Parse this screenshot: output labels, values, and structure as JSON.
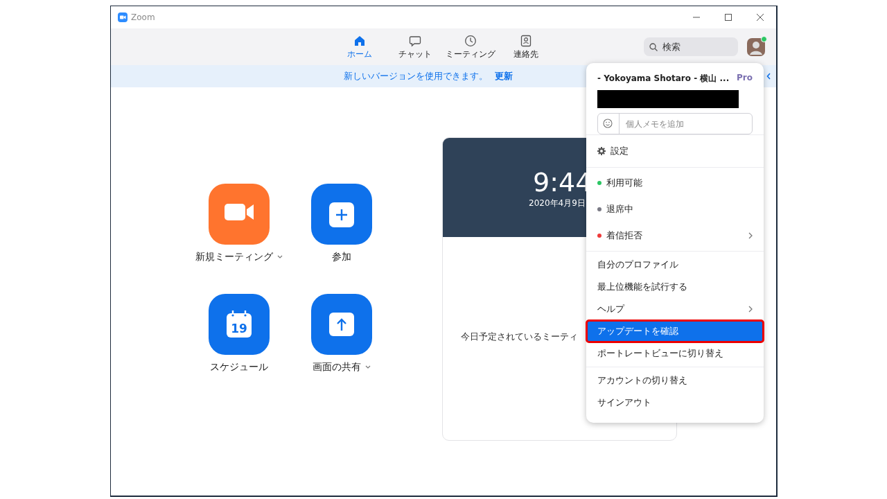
{
  "window": {
    "title": "Zoom"
  },
  "nav": {
    "tabs": [
      {
        "label": "ホーム",
        "kind": "home",
        "selected": true
      },
      {
        "label": "チャット",
        "kind": "chat",
        "selected": false
      },
      {
        "label": "ミーティング",
        "kind": "clock",
        "selected": false
      },
      {
        "label": "連絡先",
        "kind": "contact",
        "selected": false
      }
    ],
    "search": {
      "placeholder": "検索"
    },
    "avatar": {
      "online": true
    }
  },
  "banner": {
    "message": "新しいバージョンを使用できます。",
    "action": "更新"
  },
  "actions": [
    {
      "label": "新規ミーティング",
      "kind": "video",
      "color": "#ff742e",
      "dropdown": true
    },
    {
      "label": "参加",
      "kind": "plus",
      "color": "#0e71eb",
      "dropdown": false
    },
    {
      "label": "スケジュール",
      "kind": "calendar",
      "color": "#0e71eb",
      "dropdown": false
    },
    {
      "label": "画面の共有",
      "kind": "share",
      "color": "#0e71eb",
      "dropdown": true
    }
  ],
  "calendar_day": "19",
  "meeting_card": {
    "time": "9:44",
    "date": "2020年4月9日",
    "empty_message": "今日予定されているミーティ"
  },
  "profile_menu": {
    "name": "- Yokoyama Shotaro - 横山 ...",
    "plan": "Pro",
    "note": {
      "placeholder": "個人メモを追加"
    },
    "sections": [
      [
        {
          "kind": "settings",
          "label": "設定",
          "submenu": false,
          "selected": false
        }
      ],
      [
        {
          "kind": "status",
          "label": "利用可能",
          "color": "#2bc663",
          "submenu": false,
          "selected": false
        },
        {
          "kind": "status",
          "label": "退席中",
          "color": "#7a7a85",
          "submenu": false,
          "selected": false
        },
        {
          "kind": "status",
          "label": "着信拒否",
          "color": "#ee3b3b",
          "submenu": true,
          "selected": false
        }
      ],
      [
        {
          "kind": "plain",
          "label": "自分のプロファイル",
          "submenu": false,
          "selected": false
        },
        {
          "kind": "plain",
          "label": "最上位機能を試行する",
          "submenu": false,
          "selected": false
        },
        {
          "kind": "plain",
          "label": "ヘルプ",
          "submenu": true,
          "selected": false
        },
        {
          "kind": "plain",
          "label": "アップデートを確認",
          "submenu": false,
          "selected": true
        },
        {
          "kind": "plain",
          "label": "ポートレートビューに切り替え",
          "submenu": false,
          "selected": false
        }
      ],
      [
        {
          "kind": "plain",
          "label": "アカウントの切り替え",
          "submenu": false,
          "selected": false
        },
        {
          "kind": "plain",
          "label": "サインアウト",
          "submenu": false,
          "selected": false
        }
      ]
    ]
  }
}
